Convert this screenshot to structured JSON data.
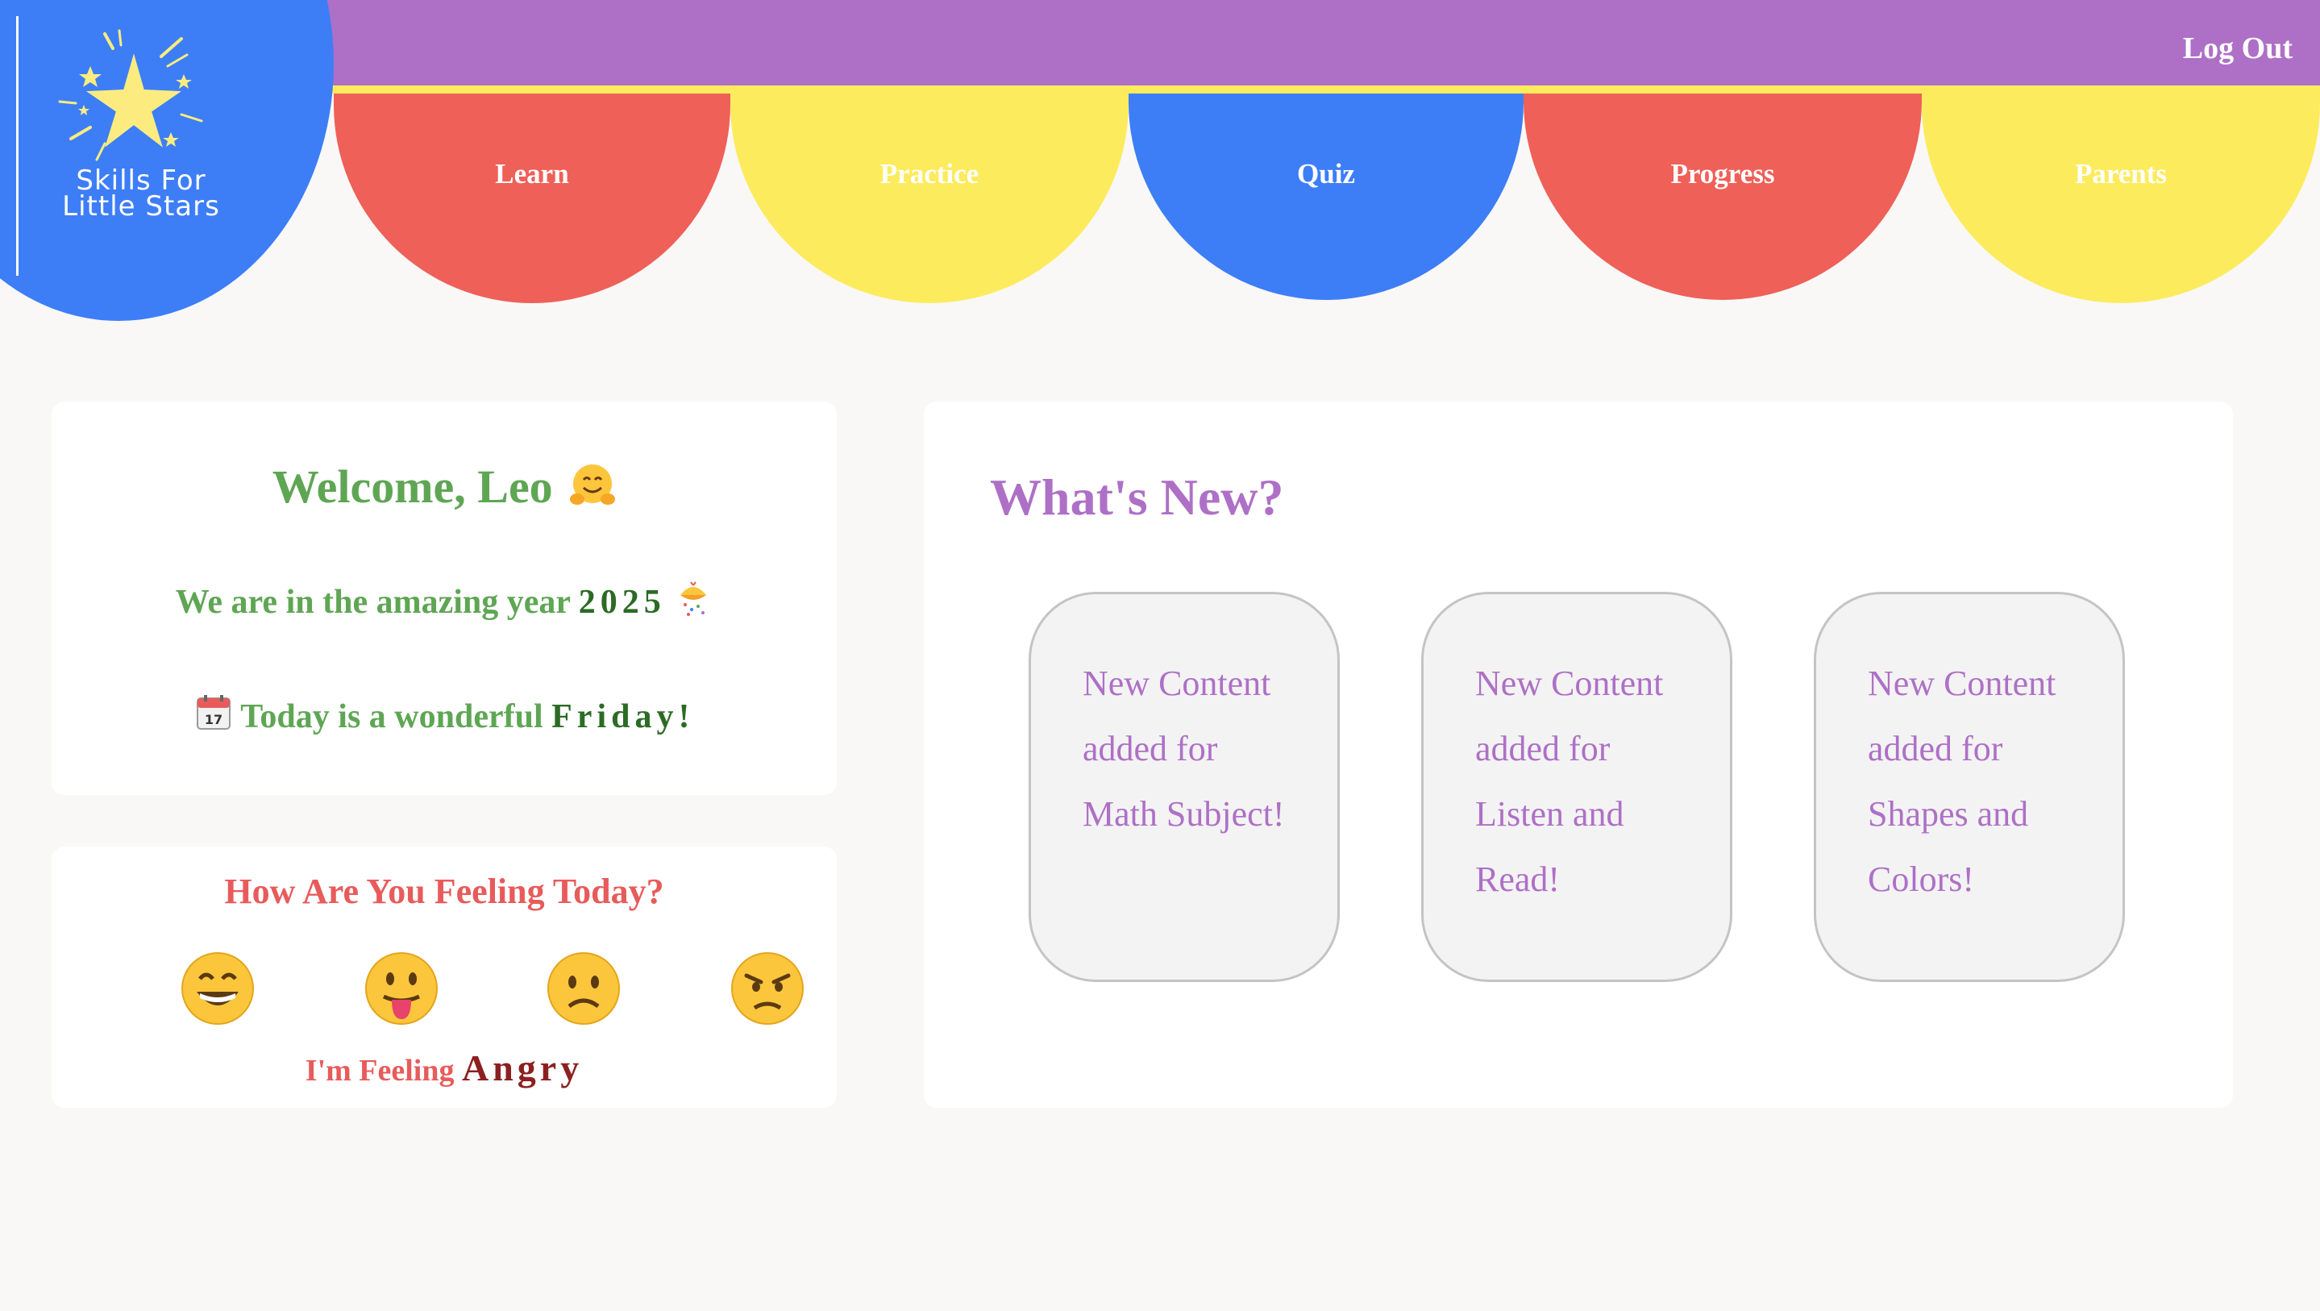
{
  "app": {
    "logo_line1": "Skills For",
    "logo_line2": "Little Stars",
    "logout_label": "Log Out"
  },
  "nav": {
    "tabs": [
      {
        "label": "Learn",
        "color": "#ef6058"
      },
      {
        "label": "Practice",
        "color": "#fdeb5e"
      },
      {
        "label": "Quiz",
        "color": "#3d7ef7"
      },
      {
        "label": "Progress",
        "color": "#ef6058"
      },
      {
        "label": "Parents",
        "color": "#fdeb5e"
      }
    ]
  },
  "welcome": {
    "greeting": "Welcome, Leo",
    "greeting_emoji": "hugging-face",
    "year_prefix": "We are in the amazing year",
    "year": "2025",
    "year_emoji": "confetti-ball",
    "today_icon": "calendar-17",
    "today_prefix": "Today is a wonderful",
    "day": "Friday",
    "today_suffix": "!"
  },
  "feeling": {
    "title": "How Are You Feeling Today?",
    "options": [
      {
        "name": "happy",
        "icon": "grinning-face"
      },
      {
        "name": "silly",
        "icon": "tongue-out-face"
      },
      {
        "name": "sad",
        "icon": "frowning-face"
      },
      {
        "name": "angry",
        "icon": "angry-face"
      }
    ],
    "selected_prefix": "I'm Feeling",
    "selected": "Angry"
  },
  "news": {
    "title": "What's New?",
    "items": [
      {
        "text": "New Content added for Math Subject!"
      },
      {
        "text": "New Content added for Listen and Read!"
      },
      {
        "text": "New Content added for Shapes and Colors!"
      }
    ]
  },
  "colors": {
    "purple": "#ae70c6",
    "yellow": "#fdeb5e",
    "red": "#ef6058",
    "blue": "#3d7ef7",
    "green": "#5fa654",
    "background": "#f9f8f7"
  }
}
